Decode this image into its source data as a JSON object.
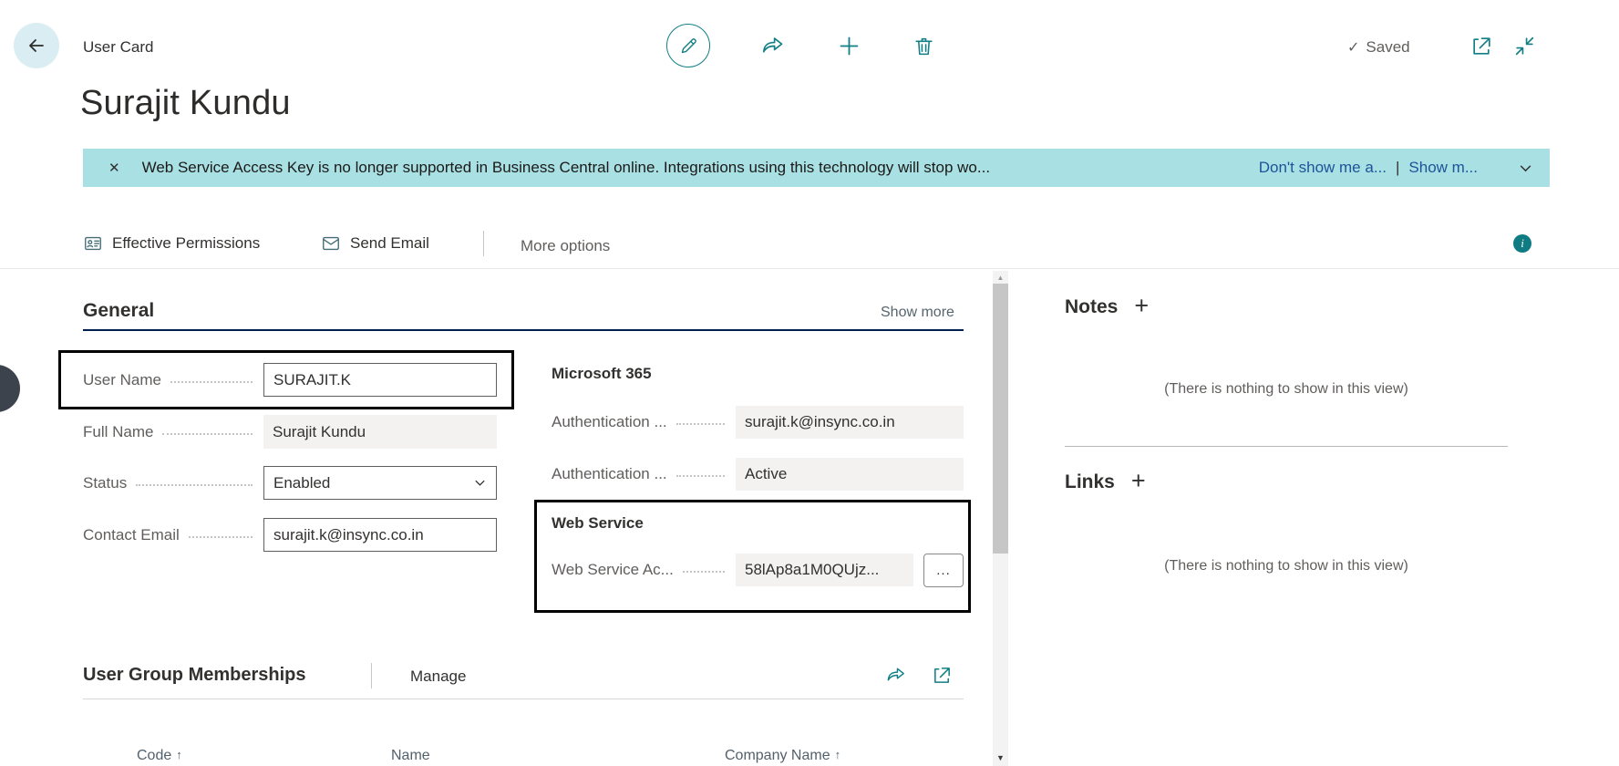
{
  "colors": {
    "accent_teal": "#117f85",
    "banner_background": "#a9e0e3",
    "banner_link_blue": "#1d5498",
    "section_underline_navy": "#002050",
    "field_readonly_gray": "#f3f2f1"
  },
  "icons": {
    "check": "✓",
    "close": "✕",
    "plus": "+",
    "ellipsis": "...",
    "sort_ascending": "↑",
    "scroll_up": "▲",
    "scroll_down": "▼",
    "info": "i"
  },
  "header": {
    "page_type": "User Card",
    "title": "Surajit Kundu",
    "saved_status": "Saved"
  },
  "banner": {
    "message": "Web Service Access Key is no longer supported in Business Central online. Integrations using this technology will stop wo...",
    "dont_show_link": "Don't show me a...",
    "link_separator": "|",
    "show_more_link": "Show m..."
  },
  "action_bar": {
    "effective_permissions": "Effective Permissions",
    "send_email": "Send Email",
    "more_options": "More options"
  },
  "general": {
    "title": "General",
    "show_more": "Show more",
    "user_name": {
      "label": "User Name",
      "value": "SURAJIT.K"
    },
    "full_name": {
      "label": "Full Name",
      "value": "Surajit Kundu"
    },
    "status": {
      "label": "Status",
      "value": "Enabled"
    },
    "contact_email": {
      "label": "Contact Email",
      "value": "surajit.k@insync.co.in"
    },
    "microsoft_365": {
      "title": "Microsoft 365",
      "authentication_email": {
        "label": "Authentication ...",
        "value": "surajit.k@insync.co.in"
      },
      "authentication_status": {
        "label": "Authentication ...",
        "value": "Active"
      }
    },
    "web_service": {
      "title": "Web Service",
      "access_key": {
        "label": "Web Service Ac...",
        "value": "58lAp8a1M0QUjz..."
      }
    }
  },
  "factbox": {
    "notes": {
      "title": "Notes",
      "empty_message": "(There is nothing to show in this view)"
    },
    "links": {
      "title": "Links",
      "empty_message": "(There is nothing to show in this view)"
    }
  },
  "memberships": {
    "title": "User Group Memberships",
    "manage": "Manage",
    "columns": {
      "code": "Code",
      "name": "Name",
      "company_name": "Company Name"
    }
  }
}
